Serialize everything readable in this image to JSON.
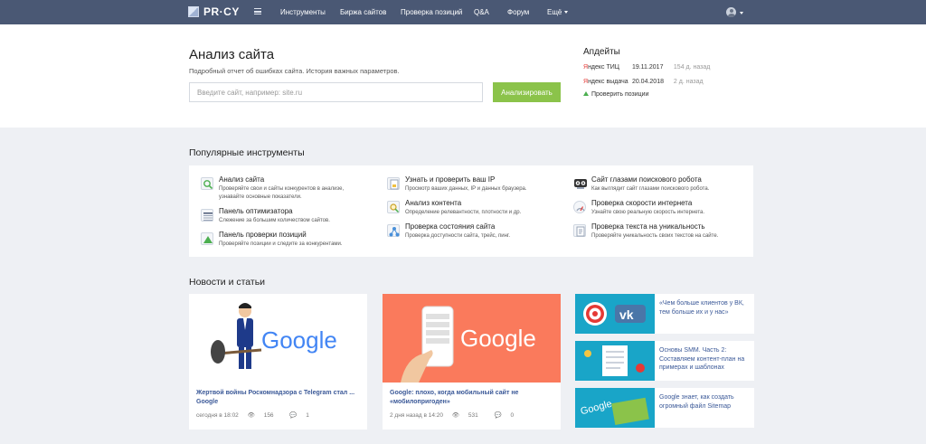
{
  "nav": {
    "logo": "PR·CY",
    "items": [
      "Инструменты",
      "Биржа сайтов",
      "Проверка позиций",
      "Q&A",
      "Форум",
      "Ещё"
    ]
  },
  "hero": {
    "title": "Анализ сайта",
    "subtitle": "Подробный отчет об ошибках сайта. История важных параметров.",
    "search_placeholder": "Введите сайт, например: site.ru",
    "analyze_label": "Анализировать"
  },
  "updates": {
    "title": "Апдейты",
    "rows": [
      {
        "first": "Я",
        "rest": "ндекс ТИЦ",
        "date": "19.11.2017",
        "ago": "154 д. назад"
      },
      {
        "first": "Я",
        "rest": "ндекс выдача",
        "date": "20.04.2018",
        "ago": "2 д. назад"
      }
    ],
    "check_positions": "Проверить позиции"
  },
  "tools": {
    "title": "Популярные инструменты",
    "items": [
      {
        "title": "Анализ сайта",
        "desc1": "Проверяйте свои и сайты конкурентов в анализе,",
        "desc2": "узнавайте основные показатели.",
        "icon": "magnifier-icon"
      },
      {
        "title": "Панель оптимизатора",
        "desc1": "Слежение за большим количеством сайтов.",
        "desc2": "",
        "icon": "spreadsheet-icon"
      },
      {
        "title": "Панель проверки позиций",
        "desc1": "Проверяйте позиции и следите за конкурентами.",
        "desc2": "",
        "icon": "chart-up-icon"
      },
      {
        "title": "Узнать и проверить ваш IP",
        "desc1": "Просмотр ваших данных, IP и данных браузера.",
        "desc2": "",
        "icon": "document-ip-icon"
      },
      {
        "title": "Анализ контента",
        "desc1": "Определение релевантности, плотности и др.",
        "desc2": "",
        "icon": "content-search-icon"
      },
      {
        "title": "Проверка состояния сайта",
        "desc1": "Проверка доступности сайта, трейс, пинг.",
        "desc2": "",
        "icon": "network-icon"
      },
      {
        "title": "Сайт глазами поискового робота",
        "desc1": "Как выглядит сайт глазами поискового робота.",
        "desc2": "",
        "icon": "robot-icon"
      },
      {
        "title": "Проверка скорости интернета",
        "desc1": "Узнайте свою реальную скорость интернета.",
        "desc2": "",
        "icon": "speedometer-icon"
      },
      {
        "title": "Проверка текста на уникальность",
        "desc1": "Проверяйте уникальность своих текстов на сайте.",
        "desc2": "",
        "icon": "text-document-icon"
      }
    ]
  },
  "news": {
    "title": "Новости и статьи",
    "cards": [
      {
        "title": "Жертвой войны Роскомнадзора с Telegram стал ... Google",
        "time": "сегодня в 18:02",
        "views": "156",
        "comments": "1",
        "img_text": "Google"
      },
      {
        "title": "Google: плохо, когда мобильный сайт не «мобилопригоден»",
        "time": "2 дня назад в 14:20",
        "views": "531",
        "comments": "0",
        "img_text": "Google"
      }
    ],
    "side": [
      {
        "title": "«Чем больше клиентов у ВК, тем больше их и у нас»"
      },
      {
        "title": "Основы SMM. Часть 2: Составляем контент-план на примерах и шаблонах"
      },
      {
        "title": "Google знает, как создать огромный файл Sitemap",
        "img_text": "Google"
      }
    ]
  },
  "colors": {
    "nav_bg": "#4a5874",
    "accent_green": "#8bc34a",
    "link_blue": "#3b5998",
    "yandex_red": "#e53935"
  }
}
